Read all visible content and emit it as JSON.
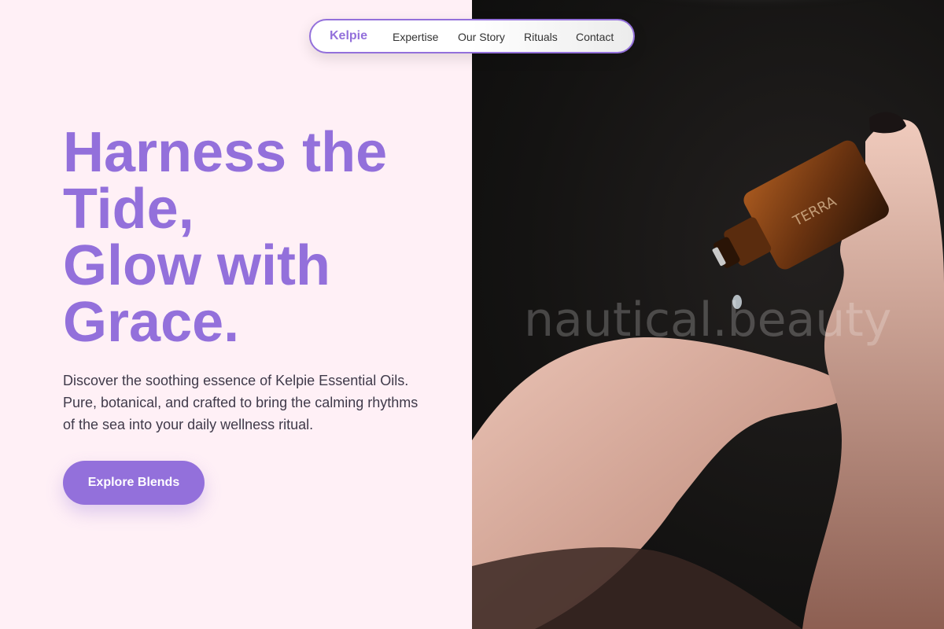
{
  "nav": {
    "brand": "Kelpie",
    "links": [
      "Expertise",
      "Our Story",
      "Rituals",
      "Contact"
    ]
  },
  "hero": {
    "title_lines": [
      "Harness the",
      "Tide,",
      "Glow with",
      "Grace."
    ],
    "description": "Discover the soothing essence of Kelpie Essential Oils. Pure, botanical, and crafted to bring the calming rhythms of the sea into your daily wellness ritual.",
    "cta_label": "Explore Blends"
  },
  "image": {
    "watermark": "nautical.beauty",
    "bottle_label": "TERRA"
  },
  "colors": {
    "accent": "#9370db",
    "background": "#fff0f6",
    "text": "#3f3a4a"
  }
}
